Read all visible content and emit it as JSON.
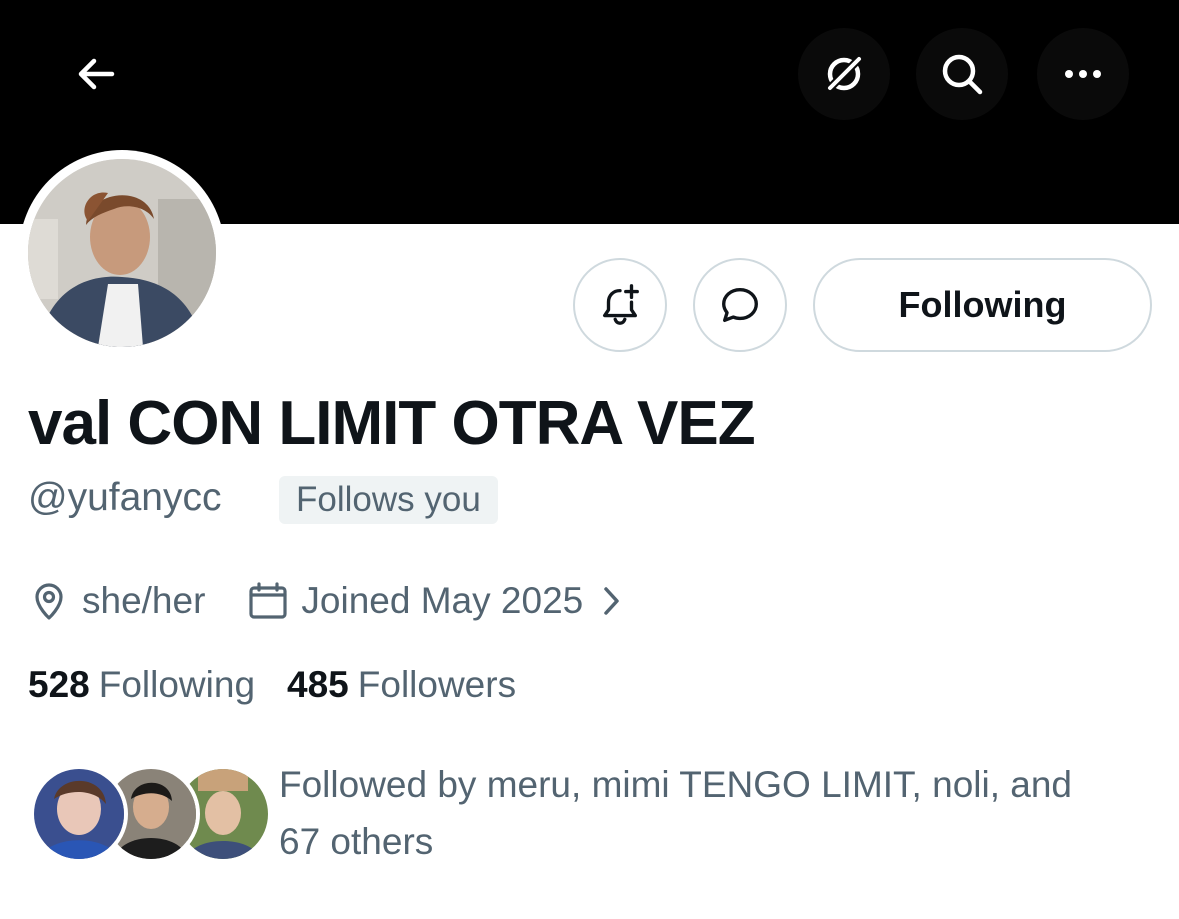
{
  "profile": {
    "display_name": "val CON LIMIT OTRA VEZ",
    "handle": "@yufanycc",
    "follows_you_badge": "Follows you",
    "pronouns": "she/her",
    "joined": "Joined May 2025",
    "following_count": "528",
    "following_label": "Following",
    "followers_count": "485",
    "followers_label": "Followers",
    "followed_by_line1": "Followed by meru, mimi TENGO LIMIT, noli, and",
    "followed_by_line2": "67 others"
  },
  "actions": {
    "following_button_label": "Following"
  },
  "icons": {
    "back": "arrow-left-icon",
    "grok": "grok-icon",
    "search": "search-icon",
    "more": "more-horizontal-icon",
    "notify": "bell-plus-icon",
    "message": "chat-bubble-icon",
    "location": "location-pin-icon",
    "calendar": "calendar-icon",
    "chevron": "chevron-right-icon"
  },
  "colors": {
    "banner": "#000000",
    "text_primary": "#0f1419",
    "text_secondary": "#536471",
    "border": "#cfd9de",
    "badge_bg": "#eff3f4"
  }
}
